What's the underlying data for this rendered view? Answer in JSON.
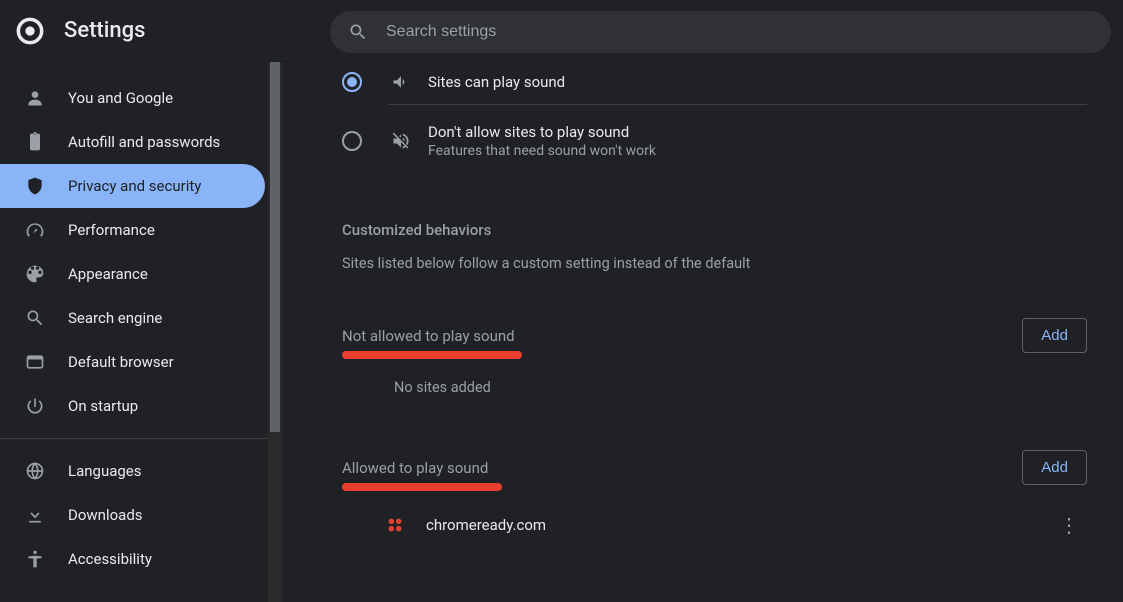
{
  "header": {
    "title": "Settings",
    "search_placeholder": "Search settings"
  },
  "sidebar": {
    "items": [
      {
        "id": "you-google",
        "label": "You and Google",
        "icon": "person"
      },
      {
        "id": "autofill",
        "label": "Autofill and passwords",
        "icon": "clipboard"
      },
      {
        "id": "privacy",
        "label": "Privacy and security",
        "icon": "shield",
        "active": true
      },
      {
        "id": "performance",
        "label": "Performance",
        "icon": "speed"
      },
      {
        "id": "appearance",
        "label": "Appearance",
        "icon": "palette"
      },
      {
        "id": "search-engine",
        "label": "Search engine",
        "icon": "search"
      },
      {
        "id": "default-browser",
        "label": "Default browser",
        "icon": "browser"
      },
      {
        "id": "startup",
        "label": "On startup",
        "icon": "power"
      }
    ],
    "items2": [
      {
        "id": "languages",
        "label": "Languages",
        "icon": "globe"
      },
      {
        "id": "downloads",
        "label": "Downloads",
        "icon": "download"
      },
      {
        "id": "accessibility",
        "label": "Accessibility",
        "icon": "accessibility"
      }
    ]
  },
  "main": {
    "radio_allow_label": "Sites can play sound",
    "radio_block_label": "Don't allow sites to play sound",
    "radio_block_desc": "Features that need sound won't work",
    "custom_heading": "Customized behaviors",
    "custom_desc": "Sites listed below follow a custom setting instead of the default",
    "not_allowed_label": "Not allowed to play sound",
    "allowed_label": "Allowed to play sound",
    "add_label": "Add",
    "no_sites": "No sites added",
    "allowed_sites": [
      {
        "name": "chromeready.com"
      }
    ]
  }
}
